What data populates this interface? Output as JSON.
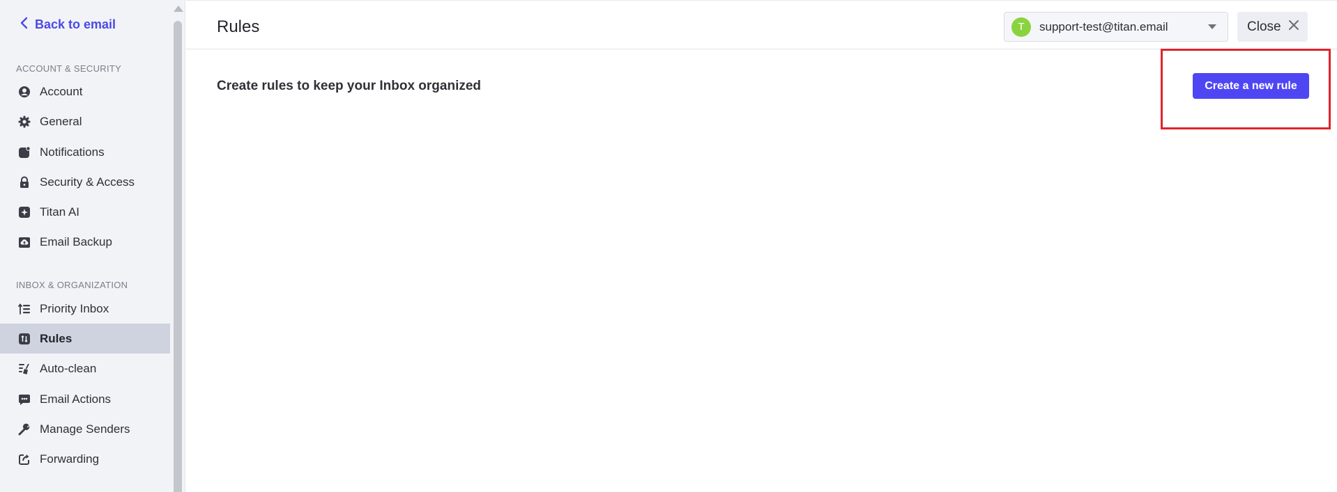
{
  "sidebar": {
    "back_label": "Back to email",
    "sections": [
      {
        "label": "ACCOUNT & SECURITY",
        "items": [
          {
            "label": "Account",
            "icon": "account-icon"
          },
          {
            "label": "General",
            "icon": "gear-icon"
          },
          {
            "label": "Notifications",
            "icon": "notification-icon"
          },
          {
            "label": "Security & Access",
            "icon": "lock-icon"
          },
          {
            "label": "Titan AI",
            "icon": "sparkle-icon"
          },
          {
            "label": "Email Backup",
            "icon": "cloud-upload-icon"
          }
        ]
      },
      {
        "label": "INBOX & ORGANIZATION",
        "items": [
          {
            "label": "Priority Inbox",
            "icon": "priority-list-icon"
          },
          {
            "label": "Rules",
            "icon": "rules-icon",
            "active": true
          },
          {
            "label": "Auto-clean",
            "icon": "broom-icon"
          },
          {
            "label": "Email Actions",
            "icon": "email-actions-icon"
          },
          {
            "label": "Manage Senders",
            "icon": "wrench-icon"
          },
          {
            "label": "Forwarding",
            "icon": "forward-icon"
          }
        ]
      }
    ]
  },
  "header": {
    "title": "Rules",
    "account": {
      "avatar_letter": "T",
      "avatar_color": "#8bd33e",
      "email": "support-test@titan.email"
    },
    "close_label": "Close"
  },
  "main": {
    "subtitle": "Create rules to keep your Inbox organized",
    "create_button_label": "Create a new rule"
  },
  "colors": {
    "accent": "#4f46f3",
    "link": "#4b49e6",
    "highlight": "#e1232c",
    "active_item_bg": "#cfd3df"
  }
}
